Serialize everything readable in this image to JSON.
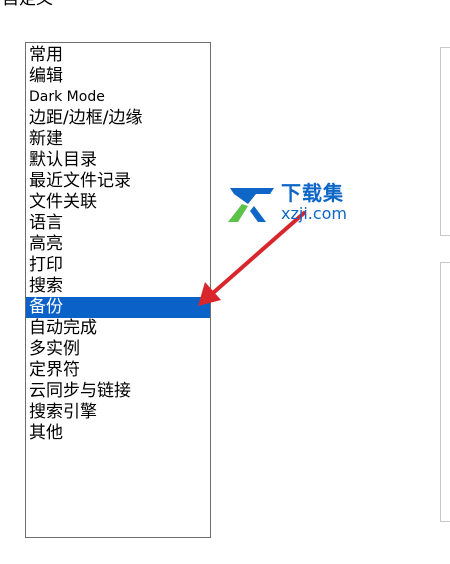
{
  "header": {
    "title_fragment": "自定义"
  },
  "categories": {
    "items": [
      {
        "label": "常用"
      },
      {
        "label": "编辑"
      },
      {
        "label": "Dark Mode"
      },
      {
        "label": "边距/边框/边缘"
      },
      {
        "label": "新建"
      },
      {
        "label": "默认目录"
      },
      {
        "label": "最近文件记录"
      },
      {
        "label": "文件关联"
      },
      {
        "label": "语言"
      },
      {
        "label": "高亮"
      },
      {
        "label": "打印"
      },
      {
        "label": "搜索"
      },
      {
        "label": "备份"
      },
      {
        "label": "自动完成"
      },
      {
        "label": "多实例"
      },
      {
        "label": "定界符"
      },
      {
        "label": "云同步与链接"
      },
      {
        "label": "搜索引擎"
      },
      {
        "label": "其他"
      }
    ],
    "selected": "备份"
  },
  "watermark": {
    "name": "下载集",
    "url": "xzji.com"
  },
  "colors": {
    "selection": "#0a62c9",
    "arrow": "#d9262c",
    "watermark_blue": "#0e67c6",
    "watermark_green": "#5cc24a"
  }
}
